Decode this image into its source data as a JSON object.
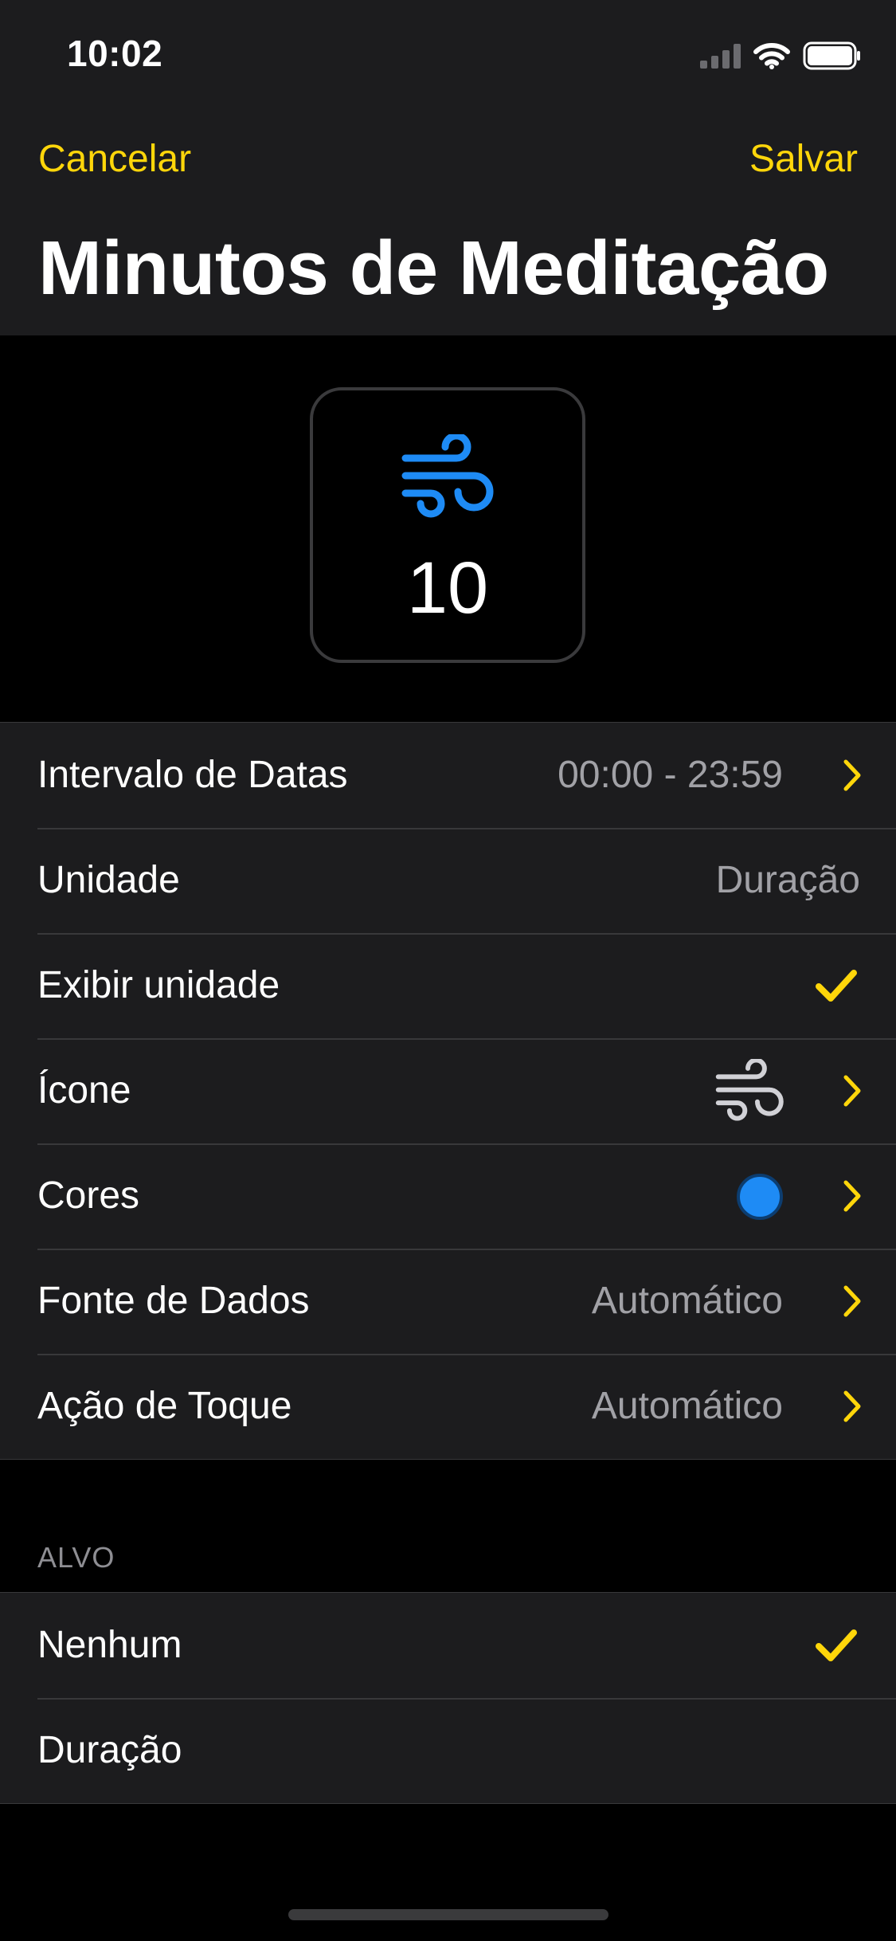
{
  "status_bar": {
    "time": "10:02"
  },
  "nav": {
    "cancel_label": "Cancelar",
    "save_label": "Salvar"
  },
  "title": "Minutos de Meditação",
  "preview": {
    "value": "10",
    "icon": "wind-icon",
    "icon_color": "#1e8bf5"
  },
  "settings": {
    "date_range": {
      "label": "Intervalo de Datas",
      "value": "00:00 - 23:59"
    },
    "unit": {
      "label": "Unidade",
      "value": "Duração"
    },
    "show_unit": {
      "label": "Exibir unidade",
      "checked": true
    },
    "icon": {
      "label": "Ícone",
      "icon": "wind-icon"
    },
    "colors": {
      "label": "Cores",
      "color": "#1e8bf5"
    },
    "data_source": {
      "label": "Fonte de Dados",
      "value": "Automático"
    },
    "tap_action": {
      "label": "Ação de Toque",
      "value": "Automático"
    }
  },
  "target": {
    "header": "ALVO",
    "options": [
      {
        "label": "Nenhum",
        "selected": true
      },
      {
        "label": "Duração",
        "selected": false
      }
    ]
  },
  "colors": {
    "accent": "#ffd60a",
    "background": "#000000",
    "cell": "#1c1c1e"
  }
}
